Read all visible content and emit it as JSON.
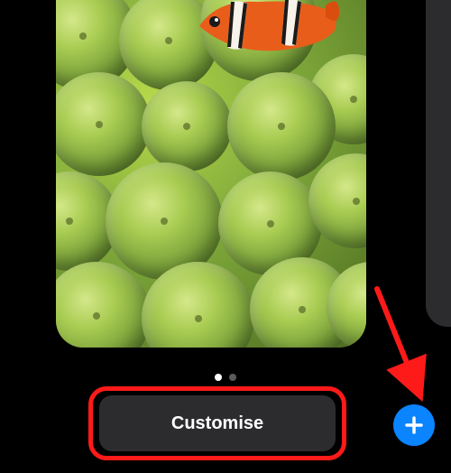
{
  "wallpaper": {
    "description": "Clownfish in green sea anemone"
  },
  "page_indicator": {
    "count": 2,
    "active_index": 0
  },
  "customise_button": {
    "label": "Customise"
  },
  "add_button": {
    "label": "+"
  },
  "colors": {
    "accent": "#0a84ff",
    "annotation": "#ff1a1a",
    "button_bg": "#2c2c2e"
  }
}
